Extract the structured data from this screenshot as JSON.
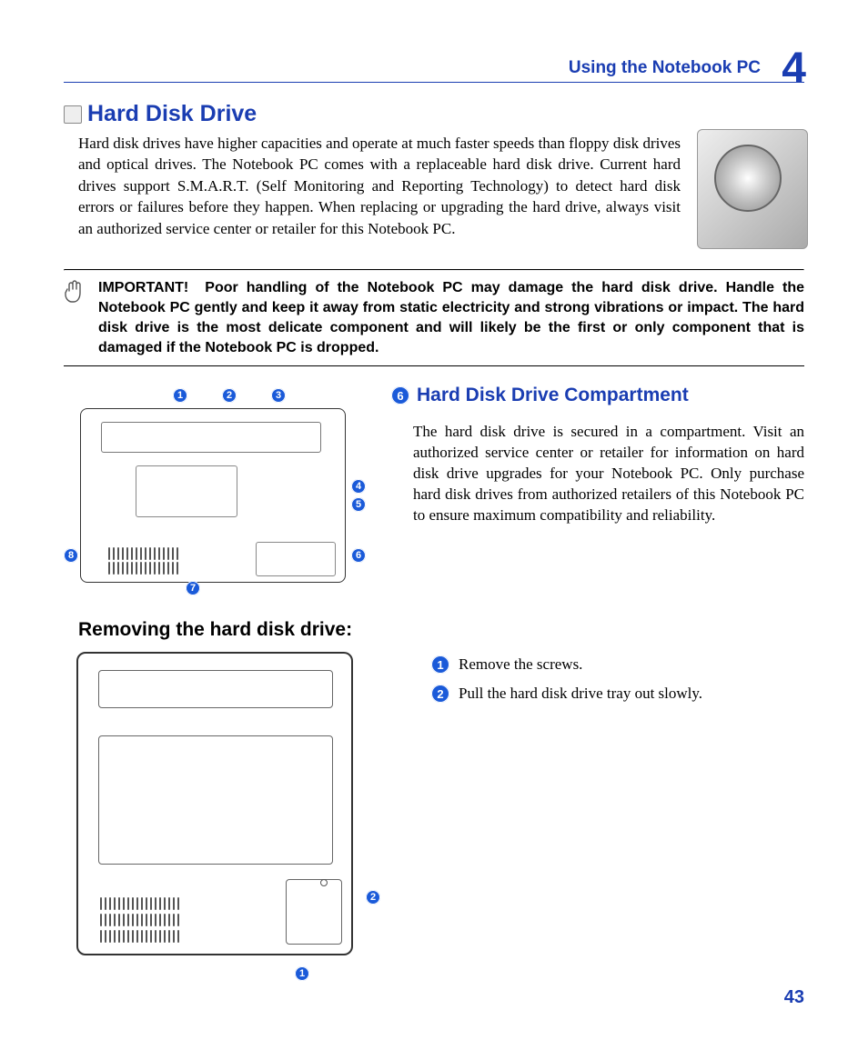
{
  "header": {
    "title": "Using the Notebook PC",
    "chapter_number": "4"
  },
  "section": {
    "title": "Hard Disk Drive",
    "intro": "Hard disk drives have higher capacities and operate at much faster speeds than floppy disk drives and optical drives. The Notebook PC comes with a replaceable hard disk drive. Current hard drives support S.M.A.R.T. (Self Monitoring and Reporting Technology) to detect hard disk errors or failures before they happen. When replacing or upgrading the hard drive, always visit an authorized service center or retailer for this Notebook PC."
  },
  "important": {
    "label": "IMPORTANT!",
    "text": "Poor handling of the Notebook PC may damage the hard disk drive. Handle the Notebook PC gently and keep it away from static electricity and strong vibrations or impact. The hard disk drive is the most delicate component and will likely be the first or only component that is damaged if the Notebook PC is dropped."
  },
  "diagram1_callouts": [
    "1",
    "2",
    "3",
    "4",
    "5",
    "6",
    "7",
    "8"
  ],
  "compartment": {
    "callout": "6",
    "title": "Hard Disk Drive Compartment",
    "text": "The hard disk drive is secured in a compartment. Visit an authorized service center or retailer for information on hard disk drive upgrades for your Notebook PC. Only purchase hard disk drives from authorized retailers of this Notebook PC to ensure maximum compatibility and reliability."
  },
  "removal": {
    "title": "Removing the hard disk drive:",
    "steps": [
      {
        "num": "1",
        "text": "Remove the screws."
      },
      {
        "num": "2",
        "text": "Pull the hard disk drive tray out slowly."
      }
    ],
    "diagram_callouts": [
      "1",
      "2"
    ]
  },
  "page_number": "43"
}
